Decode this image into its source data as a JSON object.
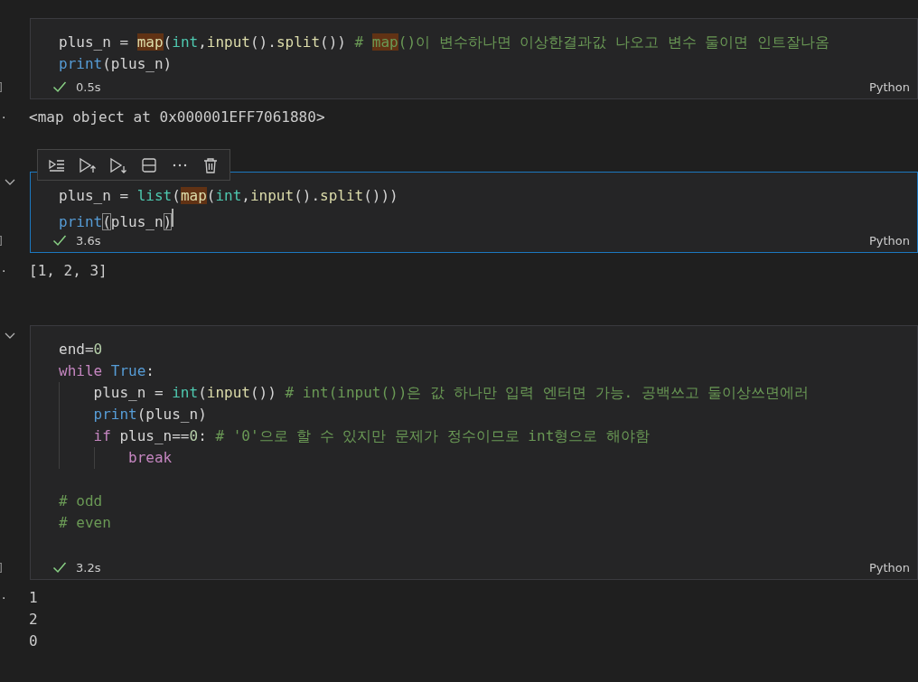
{
  "cells": [
    {
      "selected": false,
      "counter": "]",
      "lines": [
        {
          "kind": "code",
          "tokens": [
            {
              "text": "plus_n = ",
              "kind": "plain"
            },
            {
              "text": "map",
              "kind": "func",
              "highlighted": true
            },
            {
              "text": "(",
              "kind": "plain"
            },
            {
              "text": "int",
              "kind": "class"
            },
            {
              "text": ",",
              "kind": "plain"
            },
            {
              "text": "input",
              "kind": "func"
            },
            {
              "text": "().",
              "kind": "plain"
            },
            {
              "text": "split",
              "kind": "func"
            },
            {
              "text": "()) ",
              "kind": "plain"
            },
            {
              "text": "# ",
              "kind": "comment"
            },
            {
              "text": "map",
              "kind": "comment",
              "highlighted": true
            },
            {
              "text": "()이 변수하나면 이상한결과값 나오고 변수 둘이면 인트잘나옴",
              "kind": "comment"
            }
          ]
        },
        {
          "kind": "code",
          "tokens": [
            {
              "text": "print",
              "kind": "constant"
            },
            {
              "text": "(plus_n)",
              "kind": "plain"
            }
          ]
        }
      ],
      "status": {
        "ok": true,
        "time": "0.5s",
        "language": "Python"
      },
      "output": {
        "marker": "·",
        "lines": [
          "<map object at 0x000001EFF7061880>"
        ]
      }
    },
    {
      "selected": true,
      "chevron": true,
      "counter": "]",
      "toolbar": true,
      "lines": [
        {
          "kind": "code",
          "tokens": [
            {
              "text": "plus_n = ",
              "kind": "plain"
            },
            {
              "text": "list",
              "kind": "class"
            },
            {
              "text": "(",
              "kind": "plain"
            },
            {
              "text": "map",
              "kind": "func",
              "highlighted": true
            },
            {
              "text": "(",
              "kind": "plain"
            },
            {
              "text": "int",
              "kind": "class"
            },
            {
              "text": ",",
              "kind": "plain"
            },
            {
              "text": "input",
              "kind": "func"
            },
            {
              "text": "().",
              "kind": "plain"
            },
            {
              "text": "split",
              "kind": "func"
            },
            {
              "text": "()))",
              "kind": "plain"
            }
          ]
        },
        {
          "kind": "code",
          "tokens": [
            {
              "text": "print",
              "kind": "constant"
            },
            {
              "text": "(",
              "kind": "plain",
              "bracket_match": true
            },
            {
              "text": "plus_n",
              "kind": "plain"
            },
            {
              "text": ")",
              "kind": "plain",
              "bracket_match": true,
              "caret": true
            }
          ]
        }
      ],
      "status": {
        "ok": true,
        "time": "3.6s",
        "language": "Python"
      },
      "output": {
        "marker": "·",
        "lines": [
          "[1, 2, 3]"
        ]
      }
    },
    {
      "selected": false,
      "chevron": true,
      "counter": "]",
      "lines": [
        {
          "kind": "code",
          "tokens": [
            {
              "text": "end=",
              "kind": "plain"
            },
            {
              "text": "0",
              "kind": "number"
            }
          ]
        },
        {
          "kind": "code",
          "tokens": [
            {
              "text": "while",
              "kind": "keyword"
            },
            {
              "text": " True",
              "kind": "constant"
            },
            {
              "text": ":",
              "kind": "plain"
            }
          ]
        },
        {
          "kind": "code",
          "tokens": [
            {
              "text": "    plus_n = ",
              "kind": "plain"
            },
            {
              "text": "int",
              "kind": "class"
            },
            {
              "text": "(",
              "kind": "plain"
            },
            {
              "text": "input",
              "kind": "func"
            },
            {
              "text": "()) ",
              "kind": "plain"
            },
            {
              "text": "# int(input())은 값 하나만 입력 엔터면 가능. 공백쓰고 둘이상쓰면에러",
              "kind": "comment"
            }
          ]
        },
        {
          "kind": "code",
          "tokens": [
            {
              "text": "    print",
              "kind": "constant"
            },
            {
              "text": "(plus_n)",
              "kind": "plain"
            }
          ]
        },
        {
          "kind": "code",
          "tokens": [
            {
              "text": "    if",
              "kind": "keyword"
            },
            {
              "text": " plus_n==",
              "kind": "plain"
            },
            {
              "text": "0",
              "kind": "number"
            },
            {
              "text": ": ",
              "kind": "plain"
            },
            {
              "text": "# '0'으로 할 수 있지만 문제가 정수이므로 int형으로 해야함",
              "kind": "comment"
            }
          ]
        },
        {
          "kind": "code",
          "tokens": [
            {
              "text": "        break",
              "kind": "keyword"
            }
          ]
        },
        {
          "kind": "blank"
        },
        {
          "kind": "code",
          "tokens": [
            {
              "text": "# odd",
              "kind": "comment"
            }
          ]
        },
        {
          "kind": "code",
          "tokens": [
            {
              "text": "# even",
              "kind": "comment"
            }
          ]
        },
        {
          "kind": "blank"
        }
      ],
      "status": {
        "ok": true,
        "time": "3.2s",
        "language": "Python"
      },
      "output": {
        "marker": "·",
        "lines": [
          "1",
          "2",
          "0"
        ]
      }
    }
  ]
}
